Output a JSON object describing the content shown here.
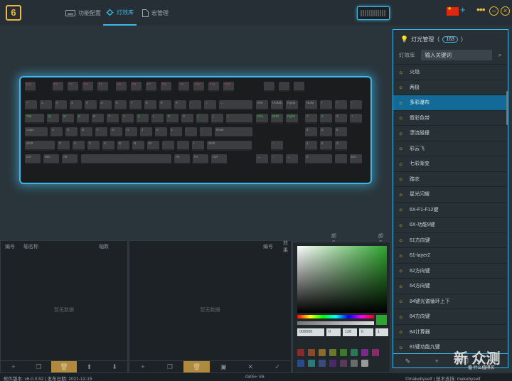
{
  "app": {
    "logo": "6"
  },
  "nav": [
    {
      "label": "功能配置",
      "icon": "keyboard-icon"
    },
    {
      "label": "灯效库",
      "icon": "gear-icon",
      "active": true
    },
    {
      "label": "宏管理",
      "icon": "document-icon"
    }
  ],
  "top": {
    "plus": "+",
    "more": "•••"
  },
  "keyboard": {
    "fn_row": [
      "Esc",
      "F1",
      "F2",
      "F3",
      "F4",
      "F5",
      "F6",
      "F7",
      "F8",
      "F9",
      "F10",
      "F11",
      "F12",
      "",
      "",
      ""
    ],
    "num_row": [
      "~",
      "1",
      "2",
      "3",
      "4",
      "5",
      "6",
      "7",
      "8",
      "9",
      "0",
      "-",
      "=",
      "←",
      "INS",
      "HOME",
      "PgUp",
      "NUM",
      "/",
      "*",
      "-"
    ],
    "tab_row": [
      "Tab",
      "Q",
      "W",
      "E",
      "R",
      "T",
      "Y",
      "U",
      "I",
      "O",
      "P",
      "[",
      "]",
      "\\",
      "DEL",
      "END",
      "PgDn",
      "7",
      "8",
      "9",
      "+"
    ],
    "caps_row": [
      "Caps",
      "A",
      "S",
      "D",
      "F",
      "G",
      "H",
      "J",
      "K",
      "L",
      ";",
      "'",
      "Enter",
      "4",
      "5",
      "6"
    ],
    "shift_row": [
      "Shift",
      "Z",
      "X",
      "C",
      "V",
      "B",
      "N",
      "M",
      ",",
      ".",
      "/",
      "Shift",
      "↑",
      "1",
      "2",
      "3"
    ],
    "ctrl_row": [
      "Ctrl",
      "Win",
      "Alt",
      "",
      "Alt",
      "Fn",
      "Ctrl",
      "←",
      "↓",
      "→",
      "0",
      ".",
      "Ent"
    ]
  },
  "side": {
    "title": "灯光管理（",
    "count": "163",
    "close_paren": "）",
    "tab_library": "灯效库",
    "search_placeholder": "输入关键词",
    "items": [
      "火焰",
      "两极",
      "多彩瀑布",
      "霓彩色带",
      "漂流碰撞",
      "彩云飞",
      "七彩渐变",
      "踏衣",
      "星光闪耀",
      "6X-F1-F12键",
      "6X-功能9键",
      "61方向键",
      "61-layer2",
      "62方向键",
      "64方向键",
      "84键光谱循环上下",
      "84方向键",
      "84计算器",
      "81键功能九键"
    ],
    "selected_index": 2
  },
  "panels": {
    "left": {
      "col1": "编号",
      "col2": "轴名称",
      "col3": "轴数",
      "empty": "暂无数据"
    },
    "mid": {
      "col1": "编号",
      "col2": "效果",
      "col3": "颜色配置",
      "col4": "颜色参数",
      "empty": "暂无数据"
    }
  },
  "color_picker": {
    "hex": "008000",
    "r": "0",
    "g": "128",
    "b": "0",
    "a": "1",
    "current_color": "#2ea52e",
    "swatches": [
      "#8b2a2a",
      "#8b4a2a",
      "#8b6a2a",
      "#6a7a2a",
      "#3a7a2a",
      "#2a7a5a",
      "#7a2a8b",
      "#8b2a6a",
      "#2a4a8b",
      "#2a7a7a",
      "#3a4a7a",
      "#4a2a6a",
      "#5a3a5a",
      "#6a6a6a",
      "#9a9a9a"
    ]
  },
  "status": {
    "version": "软件版本: v6.0.0.52 | 发布日期: 2021-12-15",
    "model": "GK6+ V6",
    "credit": "©makebyself | 技术支持: makebyself"
  },
  "watermark": {
    "main": "新 众测",
    "sub": "值 什么值得买"
  }
}
